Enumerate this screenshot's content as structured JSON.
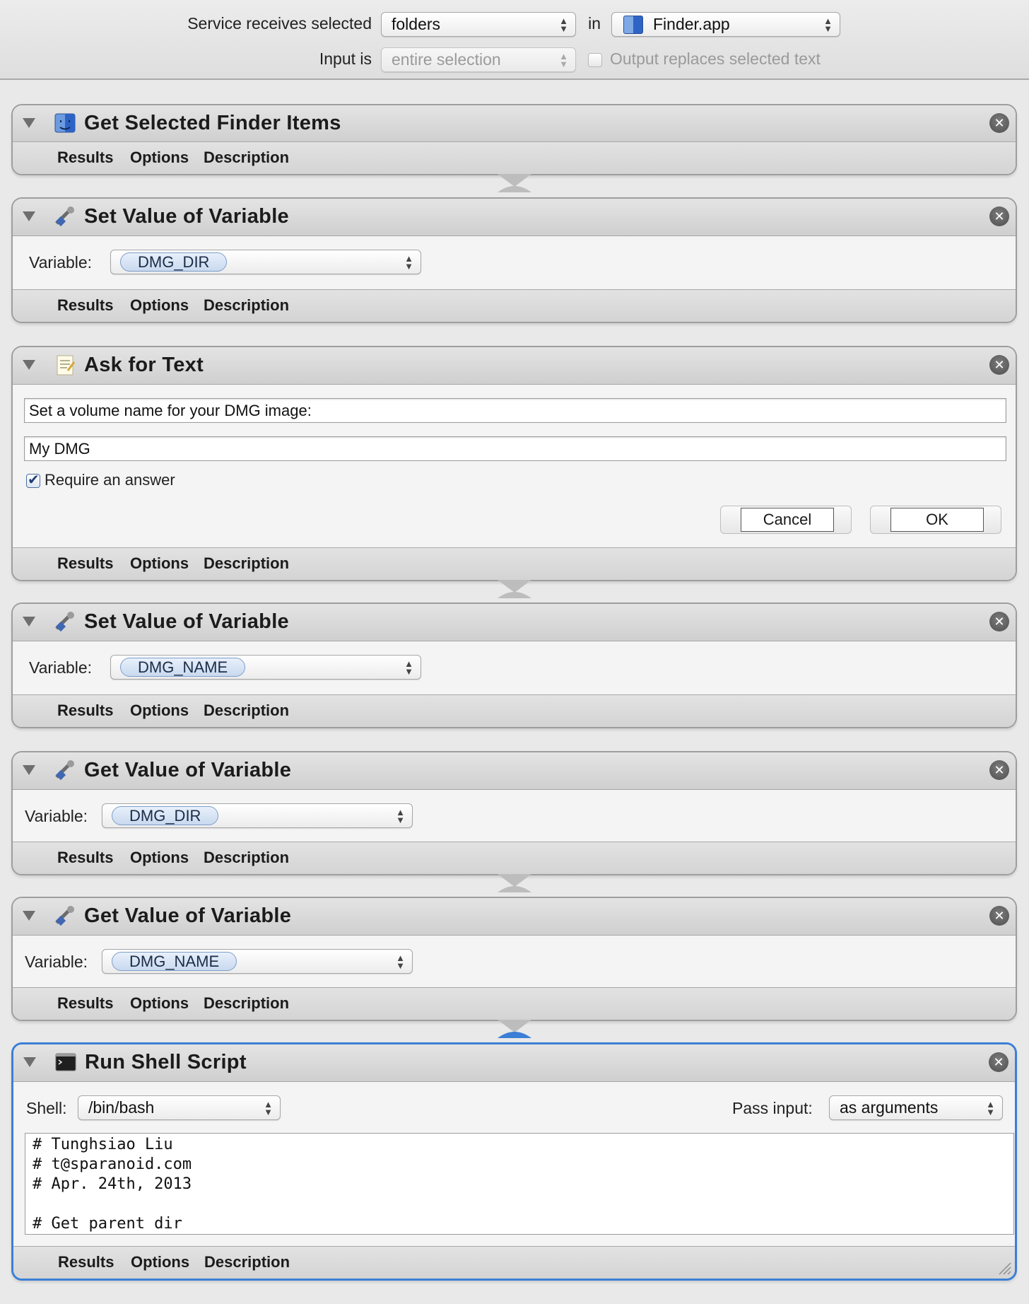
{
  "service": {
    "receives_label": "Service receives selected",
    "receives_value": "folders",
    "in_label": "in",
    "app_value": "Finder.app",
    "input_label": "Input is",
    "input_value": "entire selection",
    "output_replaces_label": "Output replaces selected text",
    "output_replaces_checked": false
  },
  "tabs": {
    "results": "Results",
    "options": "Options",
    "description": "Description"
  },
  "actions": [
    {
      "title": "Get Selected Finder Items",
      "icon": "finder-icon"
    },
    {
      "title": "Set Value of Variable",
      "icon": "variable-icon",
      "variable_label": "Variable:",
      "variable": "DMG_DIR"
    },
    {
      "title": "Ask for Text",
      "icon": "text-icon",
      "question": "Set a volume name for your DMG image:",
      "default_answer": "My DMG",
      "require_label": "Require an answer",
      "require_checked": true,
      "cancel_label": "Cancel",
      "ok_label": "OK"
    },
    {
      "title": "Set Value of Variable",
      "icon": "variable-icon",
      "variable_label": "Variable:",
      "variable": "DMG_NAME"
    },
    {
      "title": "Get Value of Variable",
      "icon": "variable-icon",
      "variable_label": "Variable:",
      "variable": "DMG_DIR"
    },
    {
      "title": "Get Value of Variable",
      "icon": "variable-icon",
      "variable_label": "Variable:",
      "variable": "DMG_NAME"
    },
    {
      "title": "Run Shell Script",
      "icon": "terminal-icon",
      "shell_label": "Shell:",
      "shell": "/bin/bash",
      "pass_input_label": "Pass input:",
      "pass_input": "as arguments",
      "script_lines": [
        "# Tunghsiao Liu",
        "# t@sparanoid.com",
        "# Apr. 24th, 2013",
        "",
        "# Get parent dir"
      ]
    }
  ],
  "colors": {
    "selected_border": "#3b7fd6",
    "token_border": "#7d9ec9",
    "close_button": "#5a5a5a"
  }
}
